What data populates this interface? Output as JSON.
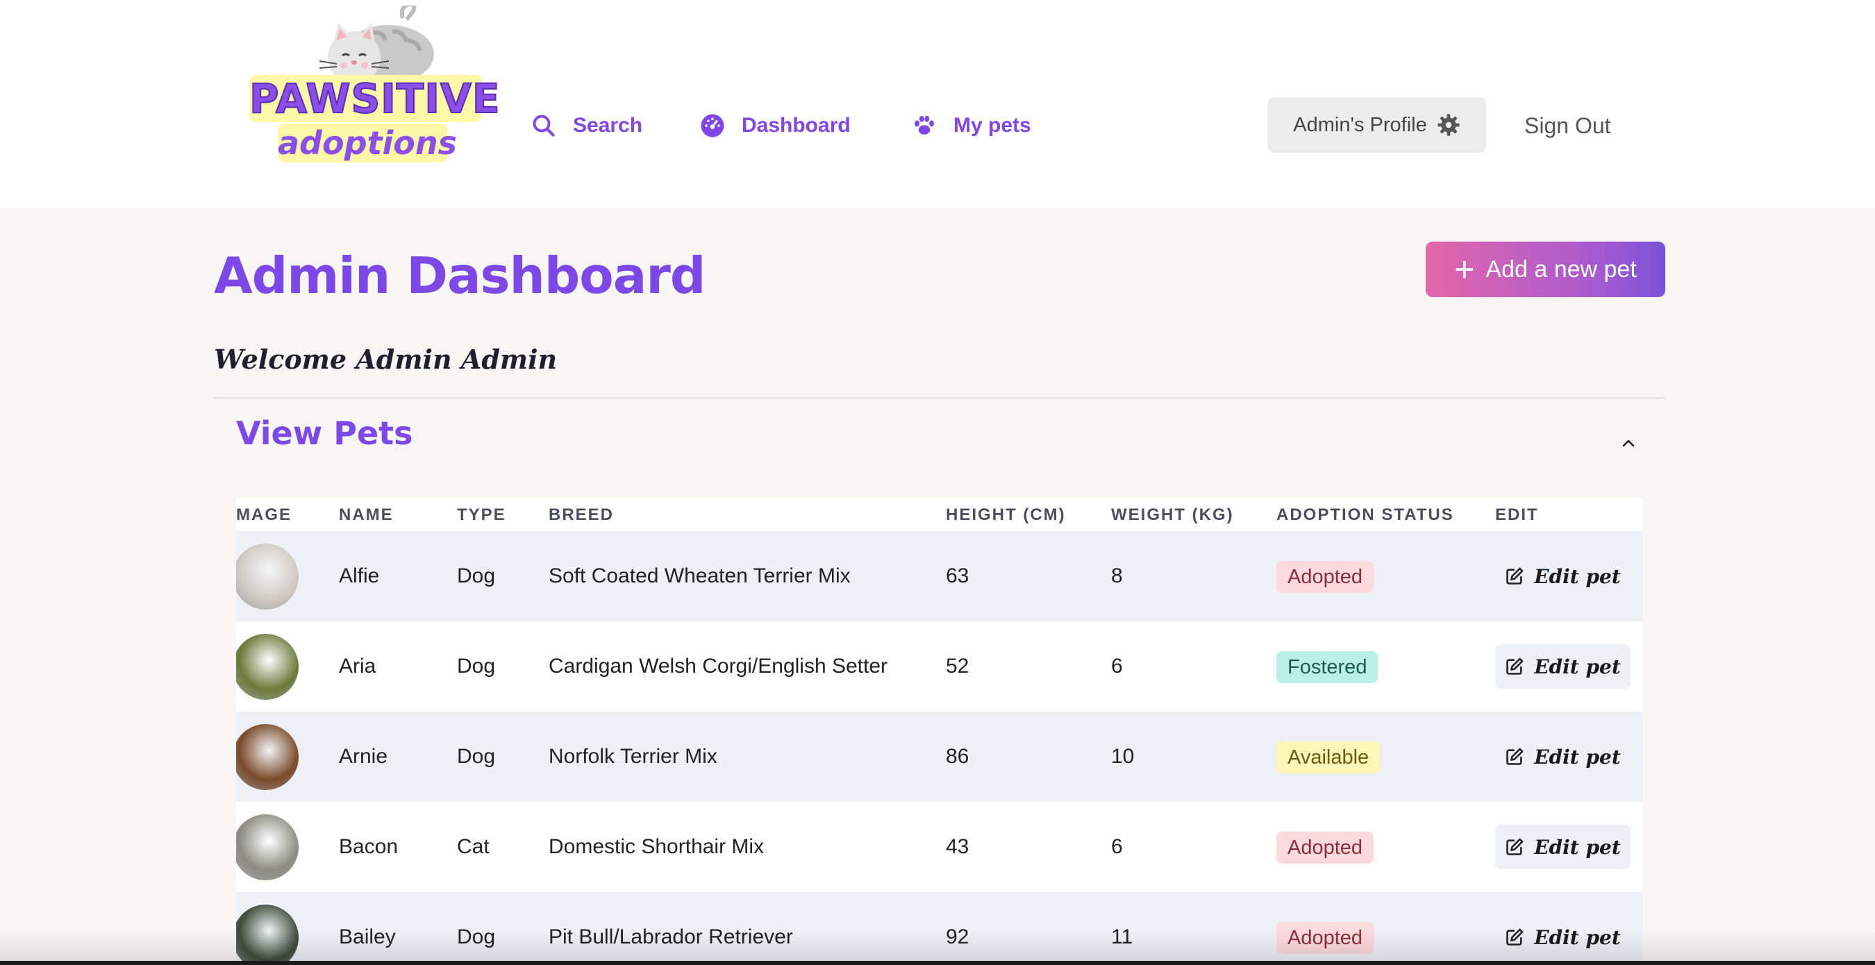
{
  "logo": {
    "line1": "PAWSITIVE",
    "line2": "adoptions"
  },
  "nav": {
    "search": {
      "label": "Search",
      "icon": "search-icon"
    },
    "dashboard": {
      "label": "Dashboard",
      "icon": "gauge-icon"
    },
    "my_pets": {
      "label": "My pets",
      "icon": "paw-icon"
    }
  },
  "profile": {
    "label": "Admin's Profile",
    "icon": "gear-icon"
  },
  "sign_out": "Sign Out",
  "page_title": "Admin Dashboard",
  "add_pet": {
    "label": "Add a new pet",
    "icon": "plus-icon"
  },
  "welcome": "Welcome Admin Admin",
  "section": {
    "title": "View Pets",
    "icon": "chevron-up-icon"
  },
  "table": {
    "headers": [
      "MAGE",
      "NAME",
      "TYPE",
      "BREED",
      "HEIGHT (CM)",
      "WEIGHT (KG)",
      "ADOPTION STATUS",
      "EDIT"
    ],
    "edit_label": "Edit pet",
    "rows": [
      {
        "name": "Alfie",
        "type": "Dog",
        "breed": "Soft Coated Wheaten Terrier Mix",
        "height": "63",
        "weight": "8",
        "status": "Adopted",
        "status_kind": "adopted",
        "photo_color": "#cfcac2"
      },
      {
        "name": "Aria",
        "type": "Dog",
        "breed": "Cardigan Welsh Corgi/English Setter",
        "height": "52",
        "weight": "6",
        "status": "Fostered",
        "status_kind": "fostered",
        "photo_color": "#6b7a3a"
      },
      {
        "name": "Arnie",
        "type": "Dog",
        "breed": "Norfolk Terrier Mix",
        "height": "86",
        "weight": "10",
        "status": "Available",
        "status_kind": "available",
        "photo_color": "#7a4a2a"
      },
      {
        "name": "Bacon",
        "type": "Cat",
        "breed": "Domestic Shorthair Mix",
        "height": "43",
        "weight": "6",
        "status": "Adopted",
        "status_kind": "adopted",
        "photo_color": "#8c8c84"
      },
      {
        "name": "Bailey",
        "type": "Dog",
        "breed": "Pit Bull/Labrador Retriever",
        "height": "92",
        "weight": "11",
        "status": "Adopted",
        "status_kind": "adopted",
        "photo_color": "#3e4a3a"
      }
    ]
  },
  "colors": {
    "accent": "#7c48e8",
    "header_bg": "#ffffff",
    "page_bg": "#f7f6f4"
  }
}
